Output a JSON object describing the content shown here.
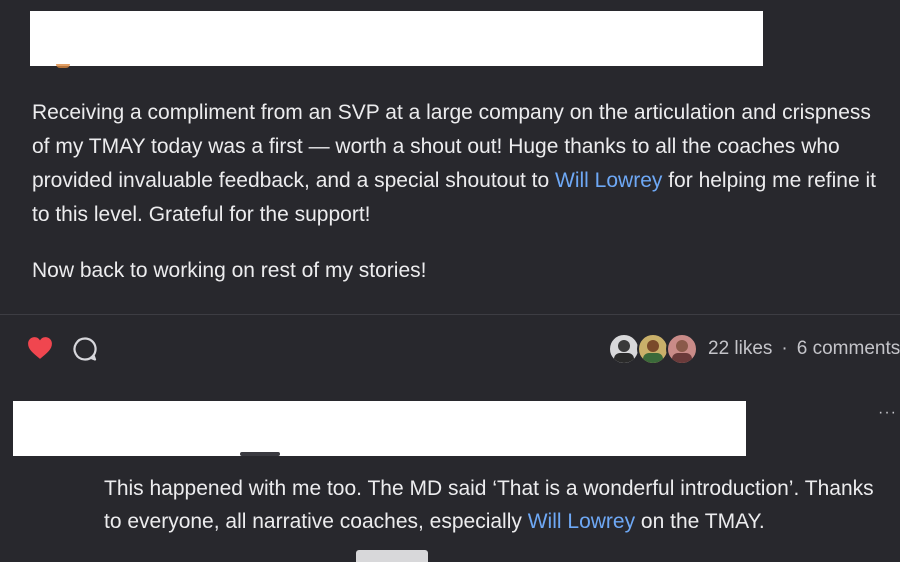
{
  "post": {
    "paragraph1_before": "Receiving a compliment from an SVP at a large company on the articulation and crispness of my TMAY today was a first — worth a shout out! Huge thanks to all the coaches who provided invaluable feedback, and a special shoutout to ",
    "mention": "Will Lowrey",
    "paragraph1_after": " for helping me refine it to this level. Grateful for the support!",
    "paragraph2": "Now back to working on rest of my stories!"
  },
  "actions": {
    "like_icon": "heart-icon",
    "comment_icon": "comment-bubble-icon",
    "likes": "22 likes",
    "separator": "·",
    "comments": "6 comments"
  },
  "comment": {
    "text_before": "This happened with me too. The MD said ‘That is a wonderful introduction’. Thanks to everyone, all narrative coaches, especially ",
    "mention": "Will Lowrey",
    "text_after": " on the TMAY.",
    "more_icon": "more-options-icon",
    "more_label": "···"
  },
  "colors": {
    "background": "#28282d",
    "text": "#ececee",
    "mention": "#6ea8f5",
    "heart": "#f0464f"
  }
}
